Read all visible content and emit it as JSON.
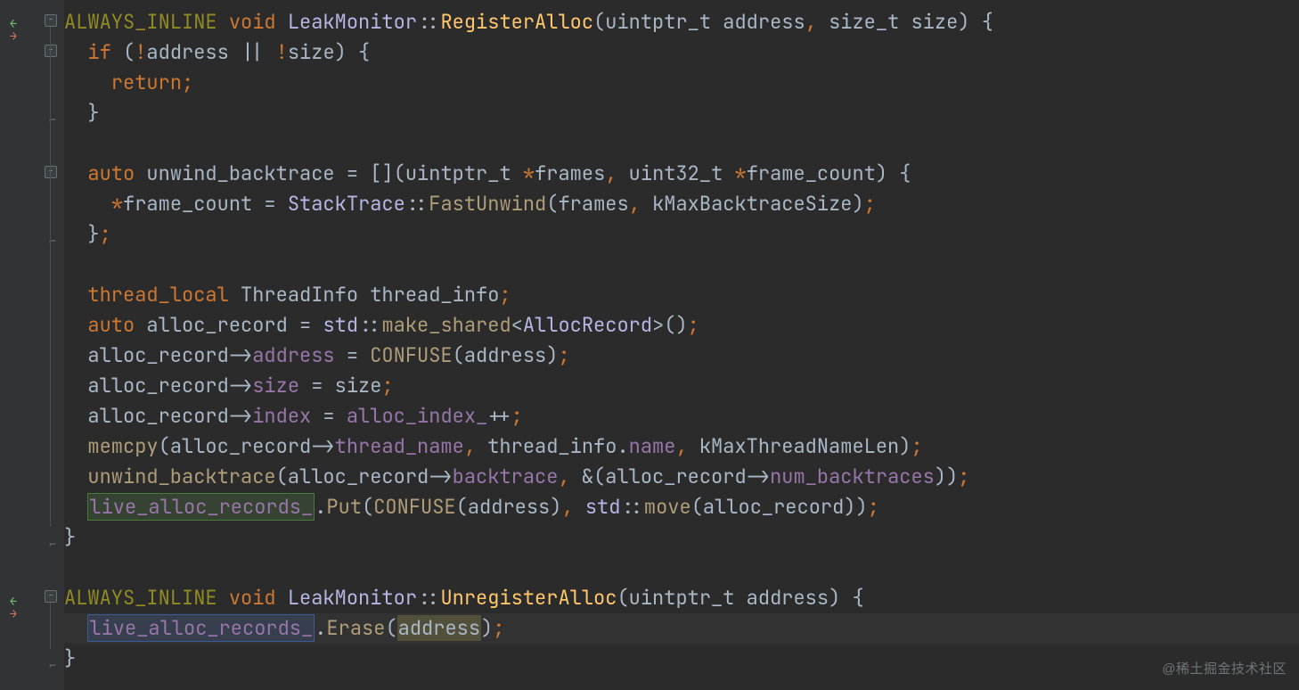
{
  "colors": {
    "bg": "#2b2b2b",
    "gutter": "#313335",
    "keyword": "#cc7832",
    "macro": "#908b25",
    "class": "#b5b6e3",
    "function": "#ffc66d",
    "member": "#9876aa",
    "default": "#a9b7c6"
  },
  "watermark": "@稀土掘金技术社区",
  "code": {
    "l1": {
      "macro": "ALWAYS_INLINE",
      "kw_void": "void",
      "cls": "LeakMonitor",
      "dcolon": "::",
      "fn": "RegisterAlloc",
      "p_open": "(",
      "t1": "uintptr_t",
      "a1": " address",
      "c1": ",",
      "t2": " size_t",
      "a2": " size",
      "p_close": ")",
      "brace": " {"
    },
    "l2": {
      "kw_if": "if ",
      "popen": "(",
      "neg1": "!",
      "a1": "address",
      "or": " || ",
      "neg2": "!",
      "a2": "size",
      "pclose": ")",
      "brace": " {"
    },
    "l3": {
      "kw_return": "return",
      "semi": ";"
    },
    "l4": {
      "brace": "}"
    },
    "l6": {
      "kw_auto": "auto ",
      "name": "unwind_backtrace",
      "eq": " = ",
      "lb": "[](",
      "t1": "uintptr_t ",
      "star": "*",
      "a1": "frames",
      "c1": ",",
      "t2": " uint32_t ",
      "star2": "*",
      "a2": "frame_count",
      "rb": ")",
      "brace": " {"
    },
    "l7": {
      "star": "*",
      "lhs": "frame_count",
      "eq": " = ",
      "cls": "StackTrace",
      "dcolon": "::",
      "fn": "FastUnwind",
      "popen": "(",
      "a1": "frames",
      "c1": ",",
      "a2": " kMaxBacktraceSize",
      "pclose": ")",
      "semi": ";"
    },
    "l8": {
      "brace": "}",
      "semi": ";"
    },
    "l10": {
      "kw_tl": "thread_local ",
      "type": "ThreadInfo ",
      "name": "thread_info",
      "semi": ";"
    },
    "l11": {
      "kw_auto": "auto ",
      "name": "alloc_record",
      "eq": " = ",
      "ns": "std",
      "dcolon": "::",
      "fn": "make_shared",
      "lt": "<",
      "tmpl": "AllocRecord",
      "gt": ">",
      "popen": "(",
      "pclose": ")",
      "semi": ";"
    },
    "l12": {
      "obj": "alloc_record",
      "arrow": "->",
      "mem": "address",
      "eq": " = ",
      "fn": "CONFUSE",
      "popen": "(",
      "arg": "address",
      "pclose": ")",
      "semi": ";"
    },
    "l13": {
      "obj": "alloc_record",
      "arrow": "->",
      "mem": "size",
      "eq": " = ",
      "rhs": "size",
      "semi": ";"
    },
    "l14": {
      "obj": "alloc_record",
      "arrow": "->",
      "mem": "index",
      "eq": " = ",
      "rhs": "alloc_index_",
      "inc": "++",
      "semi": ";"
    },
    "l15": {
      "fn": "memcpy",
      "popen": "(",
      "obj": "alloc_record",
      "arrow": "->",
      "mem": "thread_name",
      "c1": ",",
      "a2": " thread_info",
      "dot": ".",
      "mem2": "name",
      "c2": ",",
      "a3": " kMaxThreadNameLen",
      "pclose": ")",
      "semi": ";"
    },
    "l16": {
      "fn": "unwind_backtrace",
      "popen": "(",
      "obj": "alloc_record",
      "arrow": "->",
      "mem": "backtrace",
      "c1": ",",
      "amp": " &(",
      "obj2": "alloc_record",
      "arrow2": "->",
      "mem2": "num_backtraces",
      "rp": ")",
      "pclose": ")",
      "semi": ";"
    },
    "l17": {
      "field": "live_alloc_records_",
      "dot": ".",
      "fn": "Put",
      "popen": "(",
      "fn2": "CONFUSE",
      "p2o": "(",
      "arg": "address",
      "p2c": ")",
      "c1": ",",
      "ns": " std",
      "dcolon": "::",
      "fn3": "move",
      "p3o": "(",
      "arg2": "alloc_record",
      "p3c": ")",
      "pclose": ")",
      "semi": ";"
    },
    "l18": {
      "brace": "}"
    },
    "l20": {
      "macro": "ALWAYS_INLINE",
      "kw_void": "void",
      "cls": "LeakMonitor",
      "dcolon": "::",
      "fn": "UnregisterAlloc",
      "popen": "(",
      "t1": "uintptr_t",
      "a1": " address",
      "pclose": ")",
      "brace": " {"
    },
    "l21": {
      "field": "live_alloc_records_",
      "dot": ".",
      "fn": "Erase",
      "popen": "(",
      "arg": "address",
      "pclose": ")",
      "semi": ";"
    },
    "l22": {
      "brace": "}"
    }
  }
}
